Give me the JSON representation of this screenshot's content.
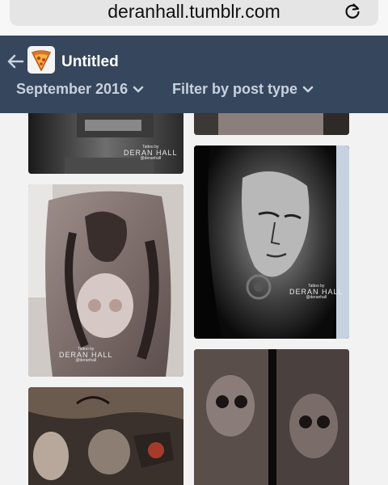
{
  "browser": {
    "domain": "deranhall.tumblr.com",
    "reload_icon": "reload-icon"
  },
  "header": {
    "title": "Untitled",
    "back_icon": "back-arrow-icon",
    "month_filter": "September 2016",
    "type_filter": "Filter by post type",
    "colors": {
      "bar": "#36465d",
      "filter_text": "#c8d1de"
    }
  },
  "posts": [
    {
      "watermark_small": "Tattoo by",
      "watermark_big": "DERAN HALL",
      "watermark_handle": "@deranhall"
    },
    {
      "watermark_small": "Tattoo by",
      "watermark_big": "DERAN HALL",
      "watermark_handle": "@deranhall"
    },
    {
      "watermark_small": "Tattoo by",
      "watermark_big": "DERAN HALL",
      "watermark_handle": "@deranhall"
    }
  ]
}
